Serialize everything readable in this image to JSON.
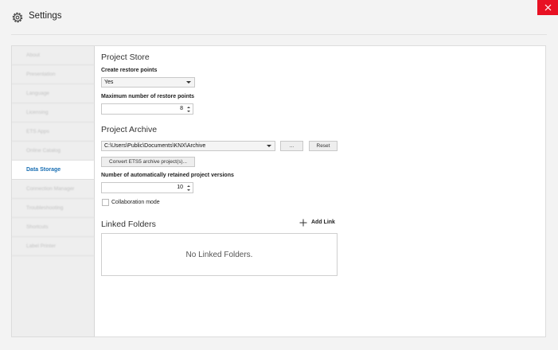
{
  "window": {
    "title": "Settings",
    "icon": "gear-icon",
    "close_icon": "close-icon",
    "close_color": "#e81123"
  },
  "sidebar": {
    "items": [
      {
        "label": "About",
        "blurred": true
      },
      {
        "label": "Presentation",
        "blurred": true
      },
      {
        "label": "Language",
        "blurred": true
      },
      {
        "label": "Licensing",
        "blurred": true
      },
      {
        "label": "ETS Apps",
        "blurred": true
      },
      {
        "label": "Online Catalog",
        "blurred": true
      },
      {
        "label": "Data Storage",
        "active": true
      },
      {
        "label": "Connection Manager",
        "blurred": true
      },
      {
        "label": "Troubleshooting",
        "blurred": true
      },
      {
        "label": "Shortcuts",
        "blurred": true
      },
      {
        "label": "Label Printer",
        "blurred": true
      }
    ],
    "active_color": "#1a6fb3"
  },
  "project_store": {
    "heading": "Project Store",
    "restore_label": "Create restore points",
    "restore_value": "Yes",
    "max_label": "Maximum number of restore points",
    "max_value": "8"
  },
  "project_archive": {
    "heading": "Project Archive",
    "path_value": "C:\\Users\\Public\\Documents\\KNX\\Archive",
    "browse_label": "...",
    "reset_label": "Reset",
    "convert_label": "Convert ETS5 archive project(s)...",
    "retained_label": "Number of automatically retained project versions",
    "retained_value": "10",
    "collab_label": "Collaboration mode",
    "collab_checked": false
  },
  "linked_folders": {
    "heading": "Linked Folders",
    "add_label": "Add Link",
    "add_icon": "plus-icon",
    "empty_text": "No Linked Folders."
  }
}
